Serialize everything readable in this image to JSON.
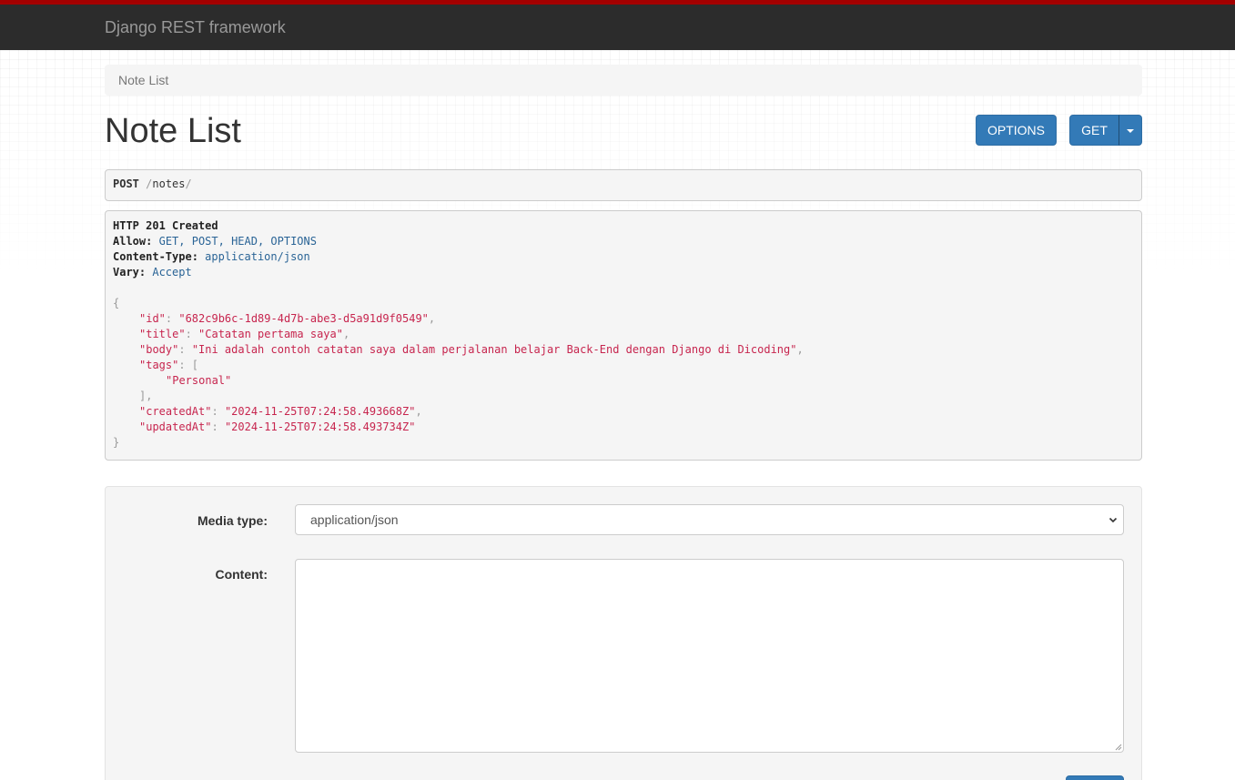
{
  "navbar": {
    "brand": "Django REST framework"
  },
  "breadcrumb": {
    "current": "Note List"
  },
  "page": {
    "title": "Note List"
  },
  "toolbar": {
    "options_label": "OPTIONS",
    "get_label": "GET"
  },
  "request": {
    "method": "POST",
    "path_sep1": "/",
    "path": "notes",
    "path_sep2": "/"
  },
  "response": {
    "status": "HTTP 201 Created",
    "headers": [
      {
        "key": "Allow:",
        "value": "GET, POST, HEAD, OPTIONS"
      },
      {
        "key": "Content-Type:",
        "value": "application/json"
      },
      {
        "key": "Vary:",
        "value": "Accept"
      }
    ],
    "body": {
      "id_key": "\"id\"",
      "id_val": "\"682c9b6c-1d89-4d7b-abe3-d5a91d9f0549\"",
      "title_key": "\"title\"",
      "title_val": "\"Catatan pertama saya\"",
      "body_key": "\"body\"",
      "body_val": "\"Ini adalah contoh catatan saya dalam perjalanan belajar Back-End dengan Django di Dicoding\"",
      "tags_key": "\"tags\"",
      "tag_0": "\"Personal\"",
      "createdAt_key": "\"createdAt\"",
      "createdAt_val": "\"2024-11-25T07:24:58.493668Z\"",
      "updatedAt_key": "\"updatedAt\"",
      "updatedAt_val": "\"2024-11-25T07:24:58.493734Z\""
    }
  },
  "form": {
    "media_type_label": "Media type:",
    "media_type_value": "application/json",
    "content_label": "Content:",
    "content_value": ""
  },
  "colors": {
    "navbar_bg": "#2c2c2c",
    "navbar_accent": "#a30000",
    "primary": "#337ab7",
    "string": "#c7254e",
    "header_value": "#2a6496"
  },
  "icons": {
    "caret": "caret-down-icon",
    "select_arrow": "chevron-down-icon",
    "resize": "resize-grip-icon"
  }
}
